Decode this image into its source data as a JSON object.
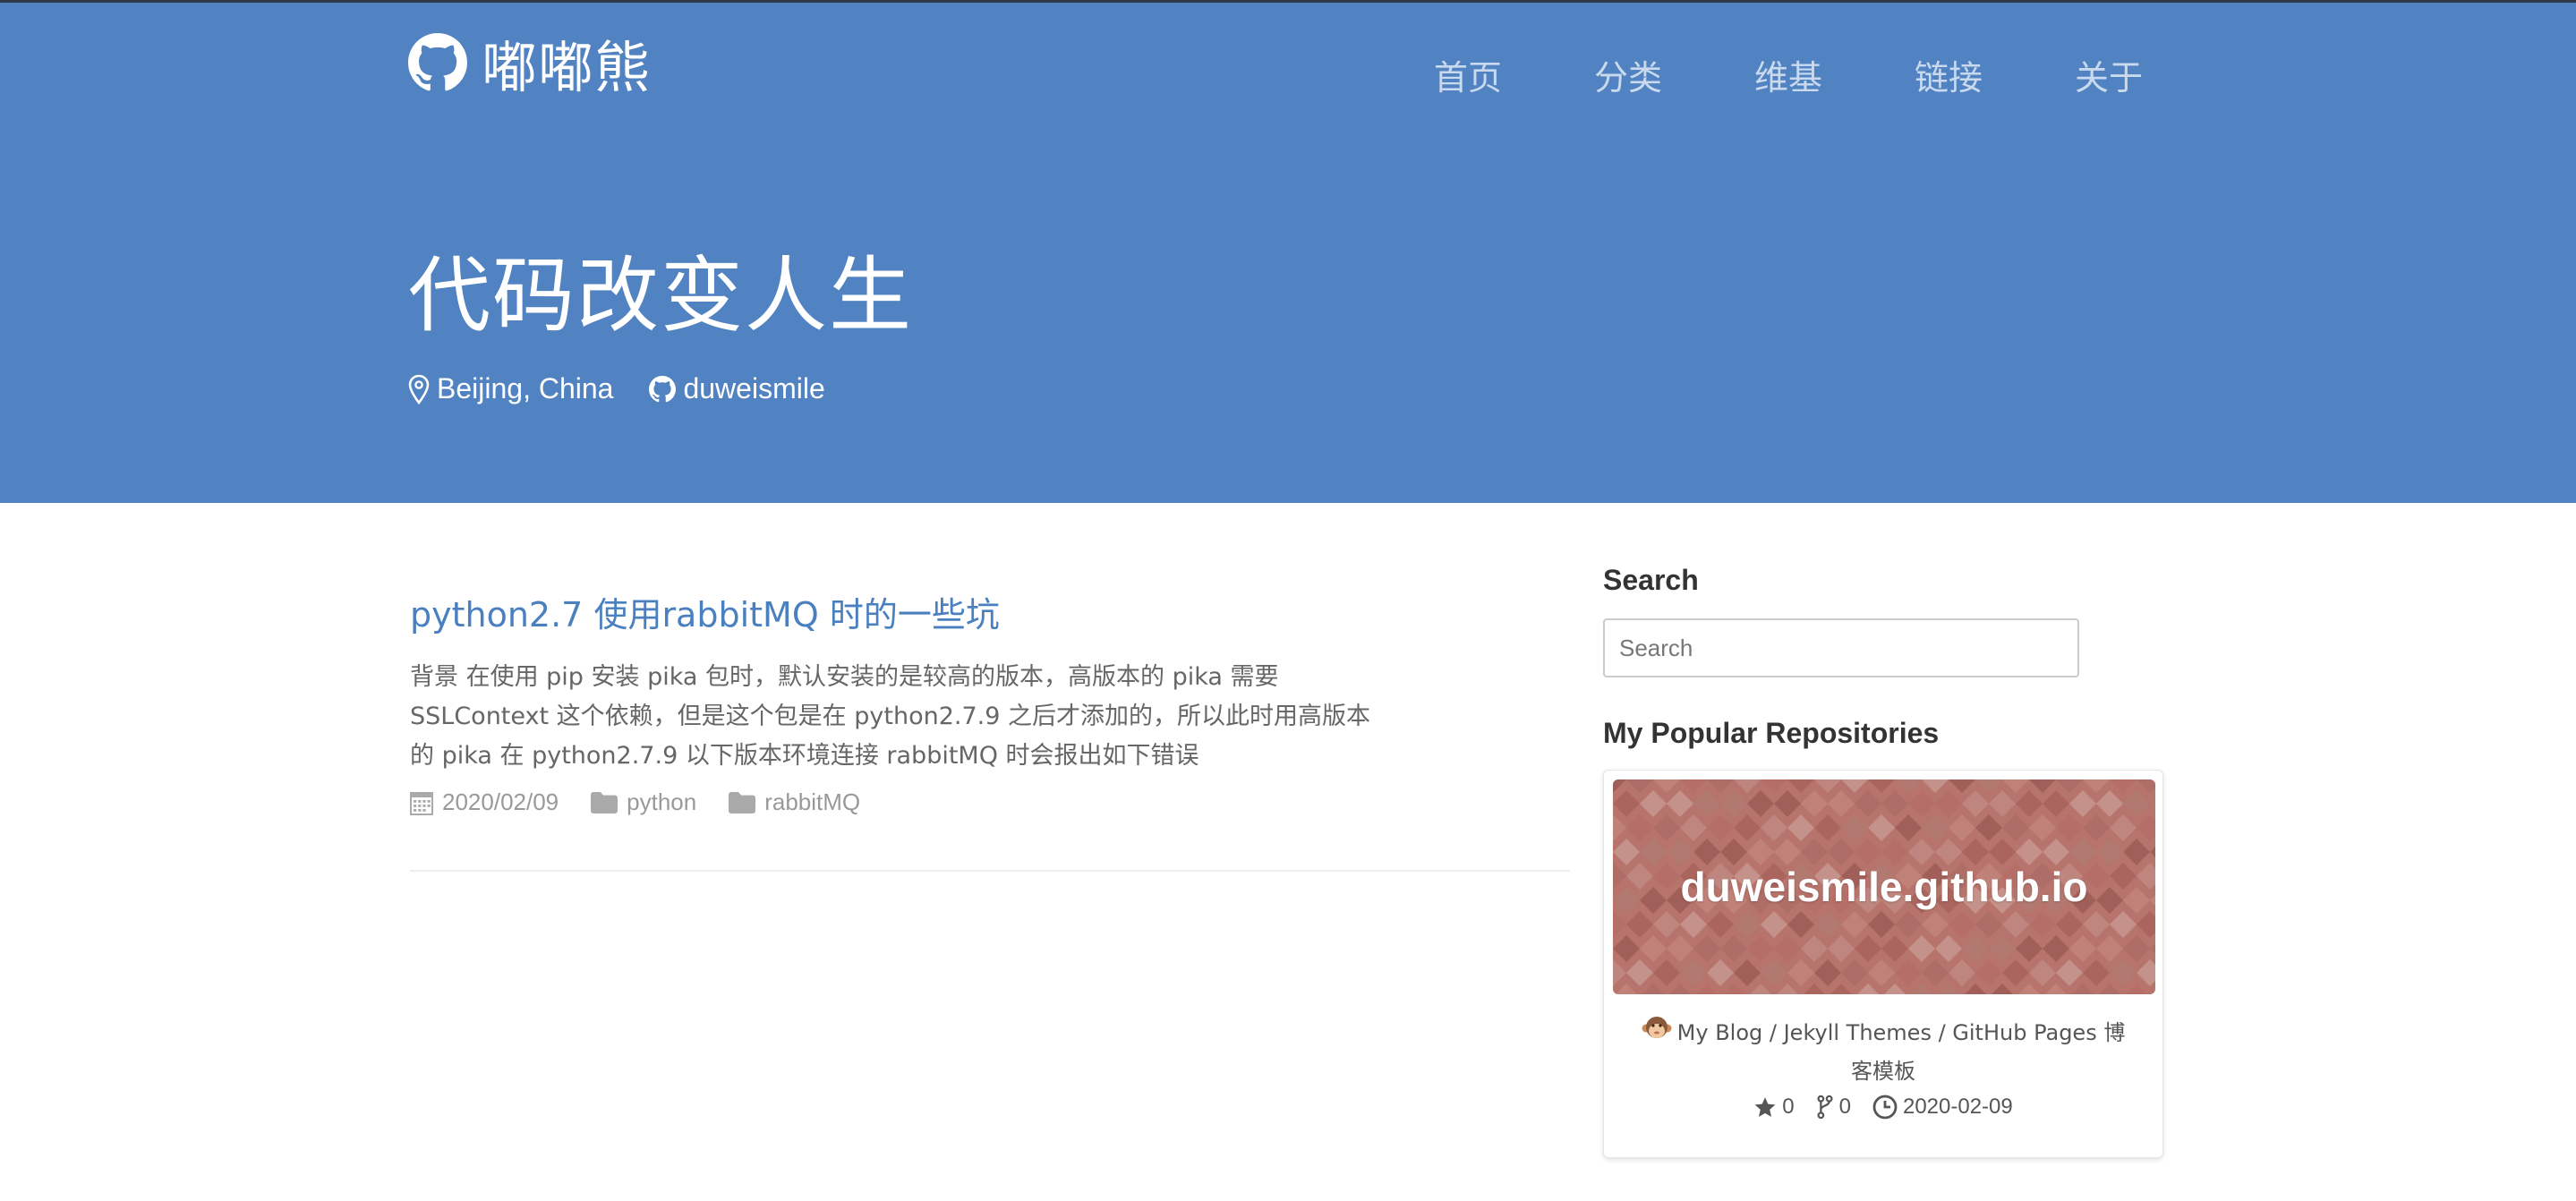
{
  "site": {
    "brand": "嘟嘟熊",
    "nav": [
      {
        "label": "首页"
      },
      {
        "label": "分类"
      },
      {
        "label": "维基"
      },
      {
        "label": "链接"
      },
      {
        "label": "关于"
      }
    ],
    "hero_title": "代码改变人生",
    "location": "Beijing, China",
    "github_user": "duweismile"
  },
  "post": {
    "title": "python2.7 使用rabbitMQ 时的一些坑",
    "excerpt": "背景 在使用 pip 安装 pika 包时，默认安装的是较高的版本，高版本的 pika 需要 SSLContext 这个依赖，但是这个包是在 python2.7.9 之后才添加的，所以此时用高版本的 pika 在 python2.7.9 以下版本环境连接 rabbitMQ 时会报出如下错误",
    "date": "2020/02/09",
    "categories": [
      "python",
      "rabbitMQ"
    ]
  },
  "sidebar": {
    "search_heading": "Search",
    "search_placeholder": "Search",
    "repos_heading": "My Popular Repositories",
    "repo": {
      "name": "duweismile.github.io",
      "description": "My Blog / Jekyll Themes / GitHub Pages 博客模板",
      "stars": "0",
      "forks": "0",
      "updated": "2020-02-09"
    }
  },
  "colors": {
    "header_bg": "#5182c1",
    "link": "#4a80c0",
    "repo_banner": "#b7746c"
  }
}
